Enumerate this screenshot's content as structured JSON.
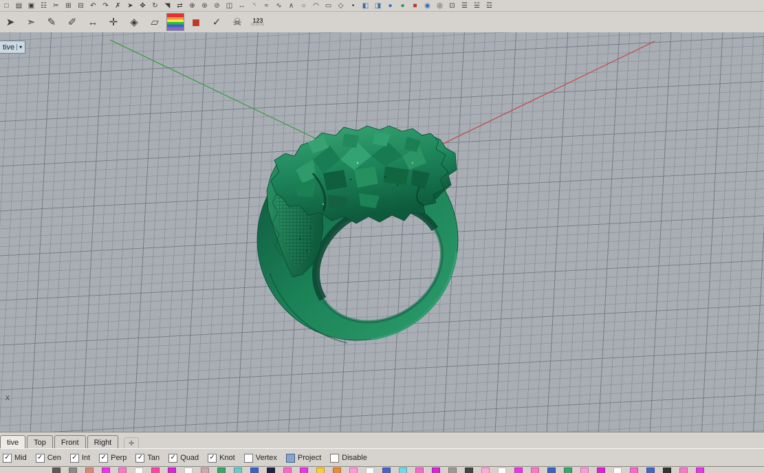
{
  "toolbar_row1": {
    "icons": [
      {
        "name": "new-file-icon",
        "glyph": "□"
      },
      {
        "name": "open-file-icon",
        "glyph": "▤"
      },
      {
        "name": "save-icon",
        "glyph": "▣"
      },
      {
        "name": "print-icon",
        "glyph": "☷"
      },
      {
        "name": "cut-icon",
        "glyph": "✂"
      },
      {
        "name": "copy-icon",
        "glyph": "⊞"
      },
      {
        "name": "paste-icon",
        "glyph": "⊟"
      },
      {
        "name": "undo-icon",
        "glyph": "↶"
      },
      {
        "name": "redo-icon",
        "glyph": "↷"
      },
      {
        "name": "delete-icon",
        "glyph": "✗"
      },
      {
        "name": "select-icon",
        "glyph": "➤"
      },
      {
        "name": "move-icon",
        "glyph": "✥"
      },
      {
        "name": "rotate-icon",
        "glyph": "↻"
      },
      {
        "name": "scale-icon",
        "glyph": "◥"
      },
      {
        "name": "mirror-icon",
        "glyph": "⇄"
      },
      {
        "name": "join-icon",
        "glyph": "⊕"
      },
      {
        "name": "explode-icon",
        "glyph": "⊛"
      },
      {
        "name": "trim-icon",
        "glyph": "⊘"
      },
      {
        "name": "split-icon",
        "glyph": "◫"
      },
      {
        "name": "extend-icon",
        "glyph": "↔"
      },
      {
        "name": "fillet-icon",
        "glyph": "◝"
      },
      {
        "name": "offset-icon",
        "glyph": "≈"
      },
      {
        "name": "curve-icon",
        "glyph": "∿"
      },
      {
        "name": "polyline-icon",
        "glyph": "∧"
      },
      {
        "name": "circle-icon",
        "glyph": "○"
      },
      {
        "name": "arc-icon",
        "glyph": "◠"
      },
      {
        "name": "rectangle-icon",
        "glyph": "▭"
      },
      {
        "name": "polygon-icon",
        "glyph": "◇"
      },
      {
        "name": "point-icon",
        "glyph": "•"
      },
      {
        "name": "surface-icon",
        "glyph": "◧",
        "color": "#3a6ea5"
      },
      {
        "name": "loft-icon",
        "glyph": "◨",
        "color": "#3a6ea5"
      },
      {
        "name": "sphere-icon",
        "glyph": "●",
        "color": "#2d6cc0"
      },
      {
        "name": "cylinder-icon",
        "glyph": "●",
        "color": "#2e8b57"
      },
      {
        "name": "box-icon",
        "glyph": "■",
        "color": "#b03a2e"
      },
      {
        "name": "shaded-view-icon",
        "glyph": "◉",
        "color": "#2d6cc0"
      },
      {
        "name": "wireframe-view-icon",
        "glyph": "◎"
      },
      {
        "name": "zoom-extents-icon",
        "glyph": "⊡"
      },
      {
        "name": "layers-icon",
        "glyph": "☰"
      },
      {
        "name": "properties-icon",
        "glyph": "☱"
      },
      {
        "name": "options-icon",
        "glyph": "☲"
      }
    ]
  },
  "toolbar_row2": {
    "icons": [
      {
        "name": "select-arrow-icon",
        "glyph": "➤"
      },
      {
        "name": "flag-direction-icon",
        "glyph": "➣"
      },
      {
        "name": "sketch-pen-icon",
        "glyph": "✎"
      },
      {
        "name": "curve-pen-icon",
        "glyph": "✐"
      },
      {
        "name": "dimension-icon",
        "glyph": "↔"
      },
      {
        "name": "pan-crosshair-icon",
        "glyph": "✛"
      },
      {
        "name": "gumball-icon",
        "glyph": "◈"
      },
      {
        "name": "cplane-icon",
        "glyph": "▱"
      },
      {
        "name": "analysis-rainbow-icon",
        "glyph": "",
        "cls": "rainbow"
      },
      {
        "name": "render-cube-icon",
        "glyph": "◼",
        "color": "#c0392b"
      },
      {
        "name": "check-icon",
        "glyph": "✓"
      },
      {
        "name": "skull-icon",
        "glyph": "☠"
      },
      {
        "name": "point-numbers-icon",
        "glyph": "123",
        "sub": "▭▭▭",
        "cls": "stack"
      }
    ]
  },
  "viewport": {
    "tab_label": "tive",
    "tab_arrow": "▾",
    "x_label": "x",
    "bg_color": "#a9aeb5",
    "grid_line_color": "#878d97",
    "axis_x_color": "#c0504d",
    "axis_y_color": "#3f9e47",
    "ring_color": "#1b8257"
  },
  "view_tabs": {
    "items": [
      {
        "label": "tive",
        "active": true
      },
      {
        "label": "Top"
      },
      {
        "label": "Front"
      },
      {
        "label": "Right"
      }
    ],
    "add_label": "✛"
  },
  "osnap": {
    "items": [
      {
        "label": "Mid",
        "checked": true
      },
      {
        "label": "Cen",
        "checked": true
      },
      {
        "label": "Int",
        "checked": true
      },
      {
        "label": "Perp",
        "checked": true
      },
      {
        "label": "Tan",
        "checked": true
      },
      {
        "label": "Quad",
        "checked": true
      },
      {
        "label": "Knot",
        "checked": true
      },
      {
        "label": "Vertex",
        "checked": false
      },
      {
        "label": "Project",
        "checked": false,
        "hl": true
      },
      {
        "label": "Disable",
        "checked": false
      }
    ]
  },
  "statusbar": {
    "icons": [
      {
        "name": "status-icon",
        "color": "#5a5a5a"
      },
      {
        "name": "status-icon",
        "color": "#8a8a8a"
      },
      {
        "name": "status-icon",
        "color": "#dd8877"
      },
      {
        "name": "status-icon",
        "color": "#ee33ee"
      },
      {
        "name": "status-icon",
        "color": "#ff77cc"
      },
      {
        "name": "status-icon",
        "color": "#ffffff"
      },
      {
        "name": "status-icon",
        "color": "#ff44aa"
      },
      {
        "name": "status-icon",
        "color": "#dd22dd"
      },
      {
        "name": "status-icon",
        "color": "#ffffff"
      },
      {
        "name": "status-icon",
        "color": "#ccaaaa"
      },
      {
        "name": "status-icon",
        "color": "#33aa66"
      },
      {
        "name": "status-icon",
        "color": "#66cccc"
      },
      {
        "name": "status-icon",
        "color": "#3366cc"
      },
      {
        "name": "status-icon",
        "color": "#222244"
      },
      {
        "name": "status-icon",
        "color": "#ff66cc"
      },
      {
        "name": "status-icon",
        "color": "#ee33ee"
      },
      {
        "name": "status-icon",
        "color": "#ffcc33"
      },
      {
        "name": "status-icon",
        "color": "#ee8833"
      },
      {
        "name": "status-icon",
        "color": "#ff99dd"
      },
      {
        "name": "status-icon",
        "color": "#ffffff"
      },
      {
        "name": "status-icon",
        "color": "#4466cc"
      },
      {
        "name": "status-icon",
        "color": "#66ddee"
      },
      {
        "name": "status-icon",
        "color": "#ff66cc"
      },
      {
        "name": "status-icon",
        "color": "#dd22dd"
      },
      {
        "name": "status-icon",
        "color": "#999999"
      },
      {
        "name": "status-icon",
        "color": "#444444"
      },
      {
        "name": "status-icon",
        "color": "#ffaadd"
      },
      {
        "name": "status-icon",
        "color": "#ffffff"
      },
      {
        "name": "status-icon",
        "color": "#ee33ee"
      },
      {
        "name": "status-icon",
        "color": "#ff77cc"
      },
      {
        "name": "status-icon",
        "color": "#3366cc"
      },
      {
        "name": "status-icon",
        "color": "#33aa66"
      },
      {
        "name": "status-icon",
        "color": "#ff99dd"
      },
      {
        "name": "status-icon",
        "color": "#dd22dd"
      },
      {
        "name": "status-icon",
        "color": "#ffffff"
      },
      {
        "name": "status-icon",
        "color": "#ff66cc"
      },
      {
        "name": "status-icon",
        "color": "#4466cc"
      },
      {
        "name": "status-icon",
        "color": "#333333"
      },
      {
        "name": "status-icon",
        "color": "#ff77cc"
      },
      {
        "name": "status-icon",
        "color": "#ee33ee"
      }
    ]
  }
}
